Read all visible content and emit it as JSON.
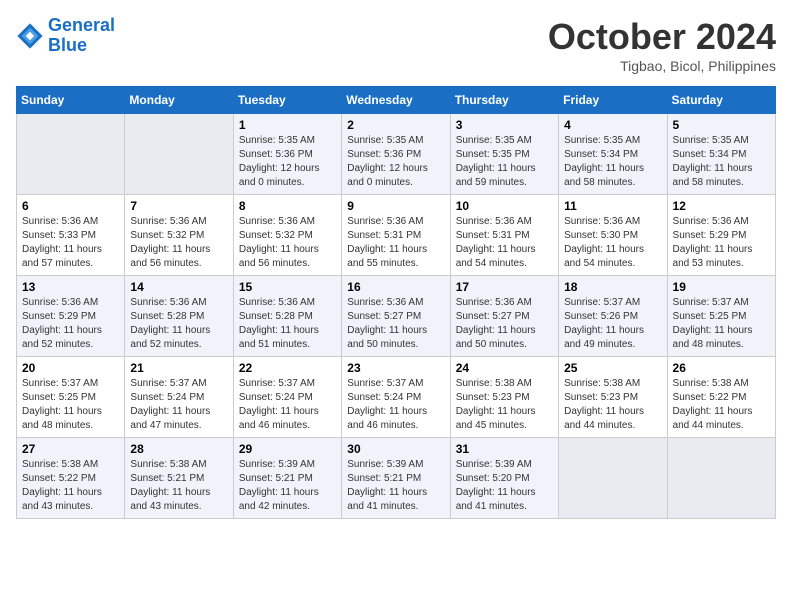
{
  "header": {
    "logo_line1": "General",
    "logo_line2": "Blue",
    "month": "October 2024",
    "location": "Tigbao, Bicol, Philippines"
  },
  "weekdays": [
    "Sunday",
    "Monday",
    "Tuesday",
    "Wednesday",
    "Thursday",
    "Friday",
    "Saturday"
  ],
  "weeks": [
    [
      {
        "day": "",
        "detail": ""
      },
      {
        "day": "",
        "detail": ""
      },
      {
        "day": "1",
        "detail": "Sunrise: 5:35 AM\nSunset: 5:36 PM\nDaylight: 12 hours\nand 0 minutes."
      },
      {
        "day": "2",
        "detail": "Sunrise: 5:35 AM\nSunset: 5:36 PM\nDaylight: 12 hours\nand 0 minutes."
      },
      {
        "day": "3",
        "detail": "Sunrise: 5:35 AM\nSunset: 5:35 PM\nDaylight: 11 hours\nand 59 minutes."
      },
      {
        "day": "4",
        "detail": "Sunrise: 5:35 AM\nSunset: 5:34 PM\nDaylight: 11 hours\nand 58 minutes."
      },
      {
        "day": "5",
        "detail": "Sunrise: 5:35 AM\nSunset: 5:34 PM\nDaylight: 11 hours\nand 58 minutes."
      }
    ],
    [
      {
        "day": "6",
        "detail": "Sunrise: 5:36 AM\nSunset: 5:33 PM\nDaylight: 11 hours\nand 57 minutes."
      },
      {
        "day": "7",
        "detail": "Sunrise: 5:36 AM\nSunset: 5:32 PM\nDaylight: 11 hours\nand 56 minutes."
      },
      {
        "day": "8",
        "detail": "Sunrise: 5:36 AM\nSunset: 5:32 PM\nDaylight: 11 hours\nand 56 minutes."
      },
      {
        "day": "9",
        "detail": "Sunrise: 5:36 AM\nSunset: 5:31 PM\nDaylight: 11 hours\nand 55 minutes."
      },
      {
        "day": "10",
        "detail": "Sunrise: 5:36 AM\nSunset: 5:31 PM\nDaylight: 11 hours\nand 54 minutes."
      },
      {
        "day": "11",
        "detail": "Sunrise: 5:36 AM\nSunset: 5:30 PM\nDaylight: 11 hours\nand 54 minutes."
      },
      {
        "day": "12",
        "detail": "Sunrise: 5:36 AM\nSunset: 5:29 PM\nDaylight: 11 hours\nand 53 minutes."
      }
    ],
    [
      {
        "day": "13",
        "detail": "Sunrise: 5:36 AM\nSunset: 5:29 PM\nDaylight: 11 hours\nand 52 minutes."
      },
      {
        "day": "14",
        "detail": "Sunrise: 5:36 AM\nSunset: 5:28 PM\nDaylight: 11 hours\nand 52 minutes."
      },
      {
        "day": "15",
        "detail": "Sunrise: 5:36 AM\nSunset: 5:28 PM\nDaylight: 11 hours\nand 51 minutes."
      },
      {
        "day": "16",
        "detail": "Sunrise: 5:36 AM\nSunset: 5:27 PM\nDaylight: 11 hours\nand 50 minutes."
      },
      {
        "day": "17",
        "detail": "Sunrise: 5:36 AM\nSunset: 5:27 PM\nDaylight: 11 hours\nand 50 minutes."
      },
      {
        "day": "18",
        "detail": "Sunrise: 5:37 AM\nSunset: 5:26 PM\nDaylight: 11 hours\nand 49 minutes."
      },
      {
        "day": "19",
        "detail": "Sunrise: 5:37 AM\nSunset: 5:25 PM\nDaylight: 11 hours\nand 48 minutes."
      }
    ],
    [
      {
        "day": "20",
        "detail": "Sunrise: 5:37 AM\nSunset: 5:25 PM\nDaylight: 11 hours\nand 48 minutes."
      },
      {
        "day": "21",
        "detail": "Sunrise: 5:37 AM\nSunset: 5:24 PM\nDaylight: 11 hours\nand 47 minutes."
      },
      {
        "day": "22",
        "detail": "Sunrise: 5:37 AM\nSunset: 5:24 PM\nDaylight: 11 hours\nand 46 minutes."
      },
      {
        "day": "23",
        "detail": "Sunrise: 5:37 AM\nSunset: 5:24 PM\nDaylight: 11 hours\nand 46 minutes."
      },
      {
        "day": "24",
        "detail": "Sunrise: 5:38 AM\nSunset: 5:23 PM\nDaylight: 11 hours\nand 45 minutes."
      },
      {
        "day": "25",
        "detail": "Sunrise: 5:38 AM\nSunset: 5:23 PM\nDaylight: 11 hours\nand 44 minutes."
      },
      {
        "day": "26",
        "detail": "Sunrise: 5:38 AM\nSunset: 5:22 PM\nDaylight: 11 hours\nand 44 minutes."
      }
    ],
    [
      {
        "day": "27",
        "detail": "Sunrise: 5:38 AM\nSunset: 5:22 PM\nDaylight: 11 hours\nand 43 minutes."
      },
      {
        "day": "28",
        "detail": "Sunrise: 5:38 AM\nSunset: 5:21 PM\nDaylight: 11 hours\nand 43 minutes."
      },
      {
        "day": "29",
        "detail": "Sunrise: 5:39 AM\nSunset: 5:21 PM\nDaylight: 11 hours\nand 42 minutes."
      },
      {
        "day": "30",
        "detail": "Sunrise: 5:39 AM\nSunset: 5:21 PM\nDaylight: 11 hours\nand 41 minutes."
      },
      {
        "day": "31",
        "detail": "Sunrise: 5:39 AM\nSunset: 5:20 PM\nDaylight: 11 hours\nand 41 minutes."
      },
      {
        "day": "",
        "detail": ""
      },
      {
        "day": "",
        "detail": ""
      }
    ]
  ]
}
